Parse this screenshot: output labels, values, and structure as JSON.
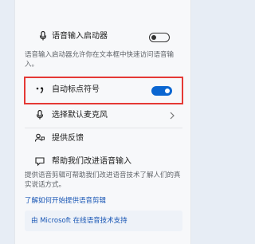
{
  "voice_launcher": {
    "title": "语音输入启动器",
    "description": "语音输入启动器允许你在文本框中快速访问语音输入。",
    "toggle_on": false
  },
  "auto_punctuation": {
    "title": "自动标点符号",
    "toggle_on": true,
    "icon": "punctuation-icon"
  },
  "default_mic": {
    "title": "选择默认麦克风",
    "chevron": "chevron-right-icon"
  },
  "feedback": {
    "title": "提供反馈"
  },
  "improve": {
    "title": "帮助我们改进语音输入",
    "description": "提供语音剪辑可帮助我们改进语音技术了解人们的真实说话方式。"
  },
  "links": {
    "learn_more": "了解如何开始提供语音剪辑",
    "ms_support": "由 Microsoft 在线语音技术支持"
  },
  "colors": {
    "accent": "#0b66d1",
    "highlight": "#e53935",
    "link": "#1755b4"
  }
}
